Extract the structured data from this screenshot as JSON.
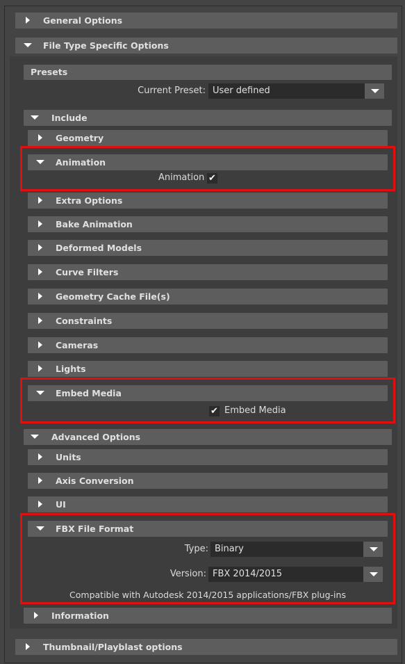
{
  "general_options": {
    "label": "General Options",
    "expanded": false
  },
  "file_type_specific": {
    "label": "File Type Specific Options",
    "expanded": true
  },
  "presets": {
    "label": "Presets",
    "current_preset_label": "Current Preset:",
    "current_preset_value": "User defined"
  },
  "include": {
    "label": "Include",
    "expanded": true,
    "sections": {
      "geometry": "Geometry",
      "animation": "Animation",
      "extra_options": "Extra Options",
      "bake_animation": "Bake Animation",
      "deformed_models": "Deformed Models",
      "curve_filters": "Curve Filters",
      "geometry_cache": "Geometry Cache File(s)",
      "constraints": "Constraints",
      "cameras": "Cameras",
      "lights": "Lights",
      "embed_media": "Embed Media"
    },
    "animation_checkbox": {
      "label": "Animation",
      "checked": true
    },
    "embed_media_checkbox": {
      "label": "Embed Media",
      "checked": true
    }
  },
  "advanced": {
    "label": "Advanced Options",
    "units": "Units",
    "axis_conversion": "Axis Conversion",
    "ui": "UI",
    "fbx_file_format": "FBX File Format",
    "type_label": "Type:",
    "type_value": "Binary",
    "version_label": "Version:",
    "version_value": "FBX 2014/2015",
    "compat_text": "Compatible with Autodesk 2014/2015 applications/FBX plug-ins"
  },
  "information": "Information",
  "thumbnail": "Thumbnail/Playblast options",
  "checkmark_glyph": "✔",
  "colors": {
    "highlight_border": "#e01010",
    "header_bg": "#5d5d5d",
    "panel_bg": "#444444",
    "field_bg": "#2b2b2b"
  }
}
